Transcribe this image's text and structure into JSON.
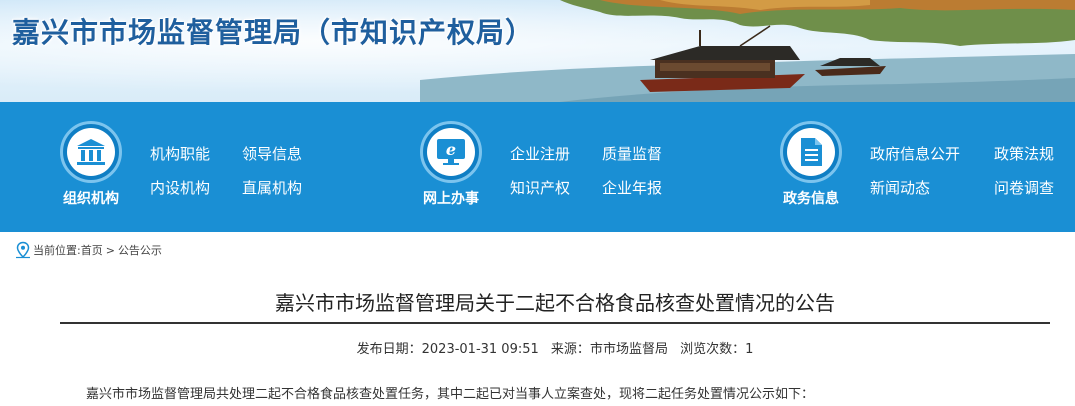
{
  "header": {
    "site_title": "嘉兴市市场监督管理局（市知识产权局）"
  },
  "nav": {
    "groups": [
      {
        "label": "组织机构",
        "icon": "building-columns-icon",
        "links": [
          "机构职能",
          "领导信息",
          "内设机构",
          "直属机构"
        ]
      },
      {
        "label": "网上办事",
        "icon": "monitor-e-icon",
        "links": [
          "企业注册",
          "质量监督",
          "知识产权",
          "企业年报"
        ]
      },
      {
        "label": "政务信息",
        "icon": "document-icon",
        "links": [
          "政府信息公开",
          "政策法规",
          "新闻动态",
          "问卷调查"
        ]
      }
    ]
  },
  "breadcrumb": {
    "prefix": "当前位置:",
    "home": "首页",
    "separator": ">",
    "current": "公告公示"
  },
  "article": {
    "title": "嘉兴市市场监督管理局关于二起不合格食品核查处置情况的公告",
    "meta": {
      "date_label": "发布日期：",
      "date": "2023-01-31 09:51",
      "source_label": "来源：",
      "source": "市市场监督局",
      "views_label": "浏览次数：",
      "views": "1"
    },
    "first_paragraph": "嘉兴市市场监督管理局共处理二起不合格食品核查处置任务，其中二起已对当事人立案查处，现将二起任务处置情况公示如下："
  },
  "colors": {
    "nav_bg": "#1a8fd4",
    "title_blue": "#1f5f9e",
    "icon_blue": "#1a8fd4"
  }
}
